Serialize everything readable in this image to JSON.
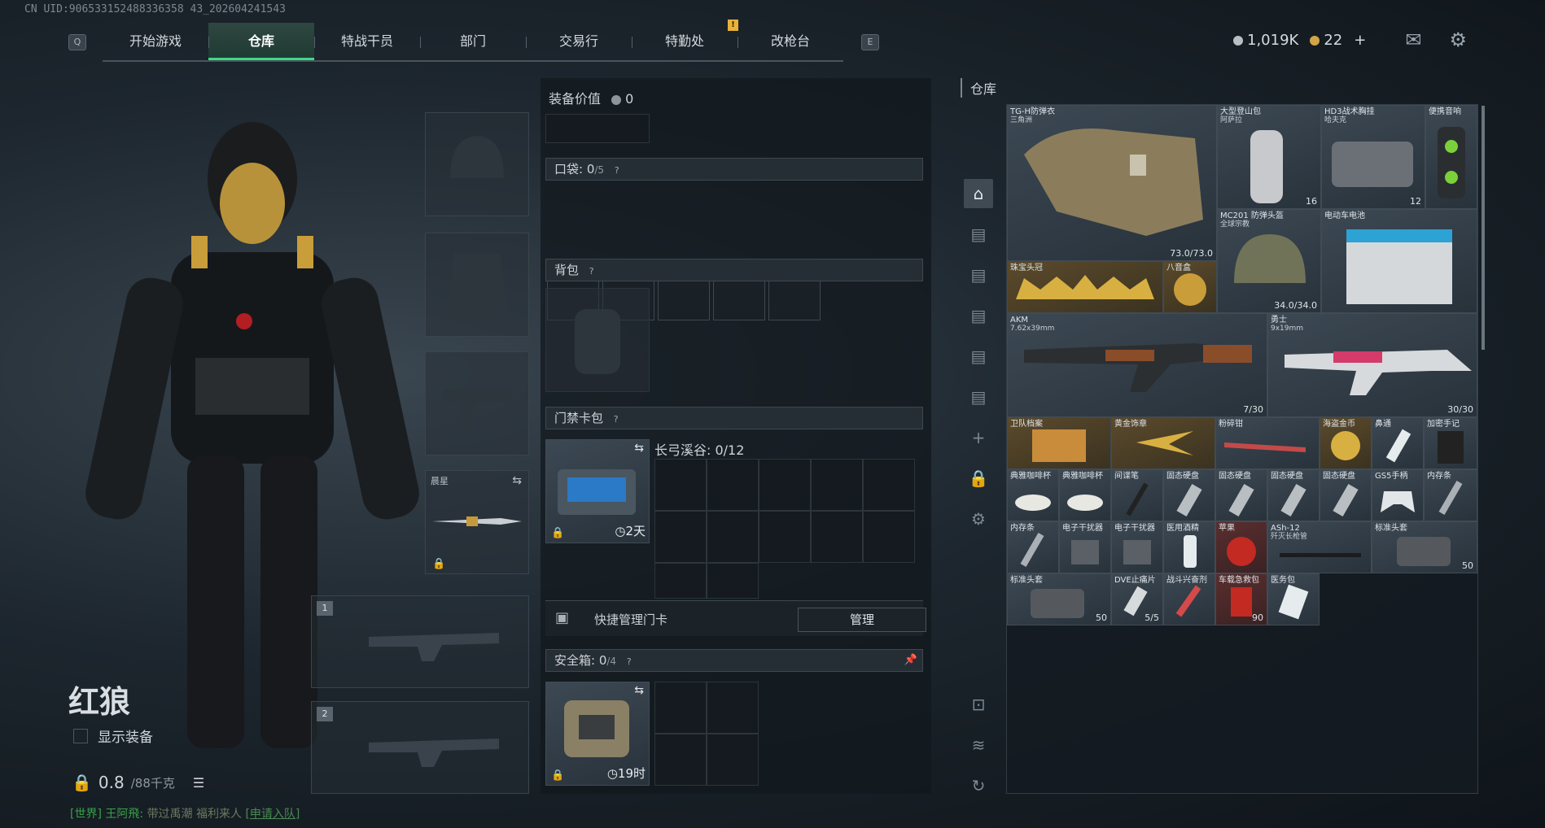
{
  "uid": "CN UID:906533152488336358 43_202604241543",
  "nav": {
    "left_key": "Q",
    "right_key": "E",
    "alert": "!",
    "tabs": [
      "开始游戏",
      "仓库",
      "特战干员",
      "部门",
      "交易行",
      "特勤处",
      "改枪台"
    ],
    "active": "仓库"
  },
  "currency": {
    "silver": "1,019K",
    "gold": "22",
    "add": "+"
  },
  "operator": {
    "name": "红狼",
    "show_gear": "显示装备",
    "weight": "0.8",
    "weight_max": "/88千克"
  },
  "chat": {
    "channel": "[世界]",
    "user": "王阿飛:",
    "message": "带过禹潮 福利来人",
    "join": "[申请入队]"
  },
  "gear_slots": {
    "melee_name": "晨星",
    "weapon_slot_1": "1",
    "weapon_slot_2": "2"
  },
  "loadout": {
    "value_label": "装备价值",
    "value": "0",
    "pocket_label": "口袋:",
    "pocket_count": "0",
    "pocket_max": "/5",
    "backpack_label": "背包",
    "keycard_label": "门禁卡包",
    "keycard_name": "长弓溪谷: 0/12",
    "keycard_timer": "2天",
    "quick_manage": "快捷管理门卡",
    "manage_button": "管理",
    "safebox_label": "安全箱:",
    "safebox_count": "0",
    "safebox_max": "/4",
    "safebox_timer": "19时",
    "help": "?"
  },
  "stash": {
    "title": "仓库",
    "items": [
      {
        "name": "TG-H防弹衣",
        "sub": "三角洲",
        "count": "73.0/73.0"
      },
      {
        "name": "大型登山包",
        "sub": "阿萨拉",
        "count": "16"
      },
      {
        "name": "HD3战术胸挂",
        "sub": "哈夫克",
        "count": "12"
      },
      {
        "name": "便携音响",
        "sub": "",
        "count": ""
      },
      {
        "name": "MC201 防弹头盔",
        "sub": "全球宗教",
        "count": "34.0/34.0"
      },
      {
        "name": "电动车电池",
        "sub": "",
        "count": ""
      },
      {
        "name": "珠宝头冠",
        "sub": "",
        "count": ""
      },
      {
        "name": "八音盒",
        "sub": "",
        "count": ""
      },
      {
        "name": "AKM",
        "sub": "7.62x39mm",
        "count": "7/30"
      },
      {
        "name": "勇士",
        "sub": "9x19mm",
        "count": "30/30"
      },
      {
        "name": "卫队档案",
        "sub": "",
        "count": ""
      },
      {
        "name": "黄金饰章",
        "sub": "",
        "count": ""
      },
      {
        "name": "粉碎钳",
        "sub": "",
        "count": ""
      },
      {
        "name": "海盗金币",
        "sub": "",
        "count": ""
      },
      {
        "name": "鼻通",
        "sub": "",
        "count": ""
      },
      {
        "name": "加密手记",
        "sub": "",
        "count": ""
      },
      {
        "name": "典雅咖啡杯",
        "sub": "",
        "count": ""
      },
      {
        "name": "典雅咖啡杯",
        "sub": "",
        "count": ""
      },
      {
        "name": "间谍笔",
        "sub": "",
        "count": ""
      },
      {
        "name": "固态硬盘",
        "sub": "",
        "count": ""
      },
      {
        "name": "固态硬盘",
        "sub": "",
        "count": ""
      },
      {
        "name": "固态硬盘",
        "sub": "",
        "count": ""
      },
      {
        "name": "固态硬盘",
        "sub": "",
        "count": ""
      },
      {
        "name": "GS5手柄",
        "sub": "",
        "count": ""
      },
      {
        "name": "内存条",
        "sub": "",
        "count": ""
      },
      {
        "name": "内存条",
        "sub": "",
        "count": ""
      },
      {
        "name": "电子干扰器",
        "sub": "",
        "count": ""
      },
      {
        "name": "电子干扰器",
        "sub": "",
        "count": ""
      },
      {
        "name": "医用酒精",
        "sub": "",
        "count": ""
      },
      {
        "name": "苹果",
        "sub": "",
        "count": ""
      },
      {
        "name": "ASh-12",
        "sub": "歼灭长枪管",
        "count": ""
      },
      {
        "name": "标准头套",
        "sub": "",
        "count": "50"
      },
      {
        "name": "标准头套",
        "sub": "",
        "count": "50"
      },
      {
        "name": "DVE止痛片",
        "sub": "",
        "count": "5/5"
      },
      {
        "name": "战斗兴奋剂",
        "sub": "",
        "count": ""
      },
      {
        "name": "车载急救包",
        "sub": "",
        "count": "90"
      },
      {
        "name": "医务包",
        "sub": "",
        "count": ""
      }
    ]
  },
  "colors": {
    "accent": "#3fd88c",
    "alert": "#e8b23a",
    "gold": "#d1a545"
  }
}
